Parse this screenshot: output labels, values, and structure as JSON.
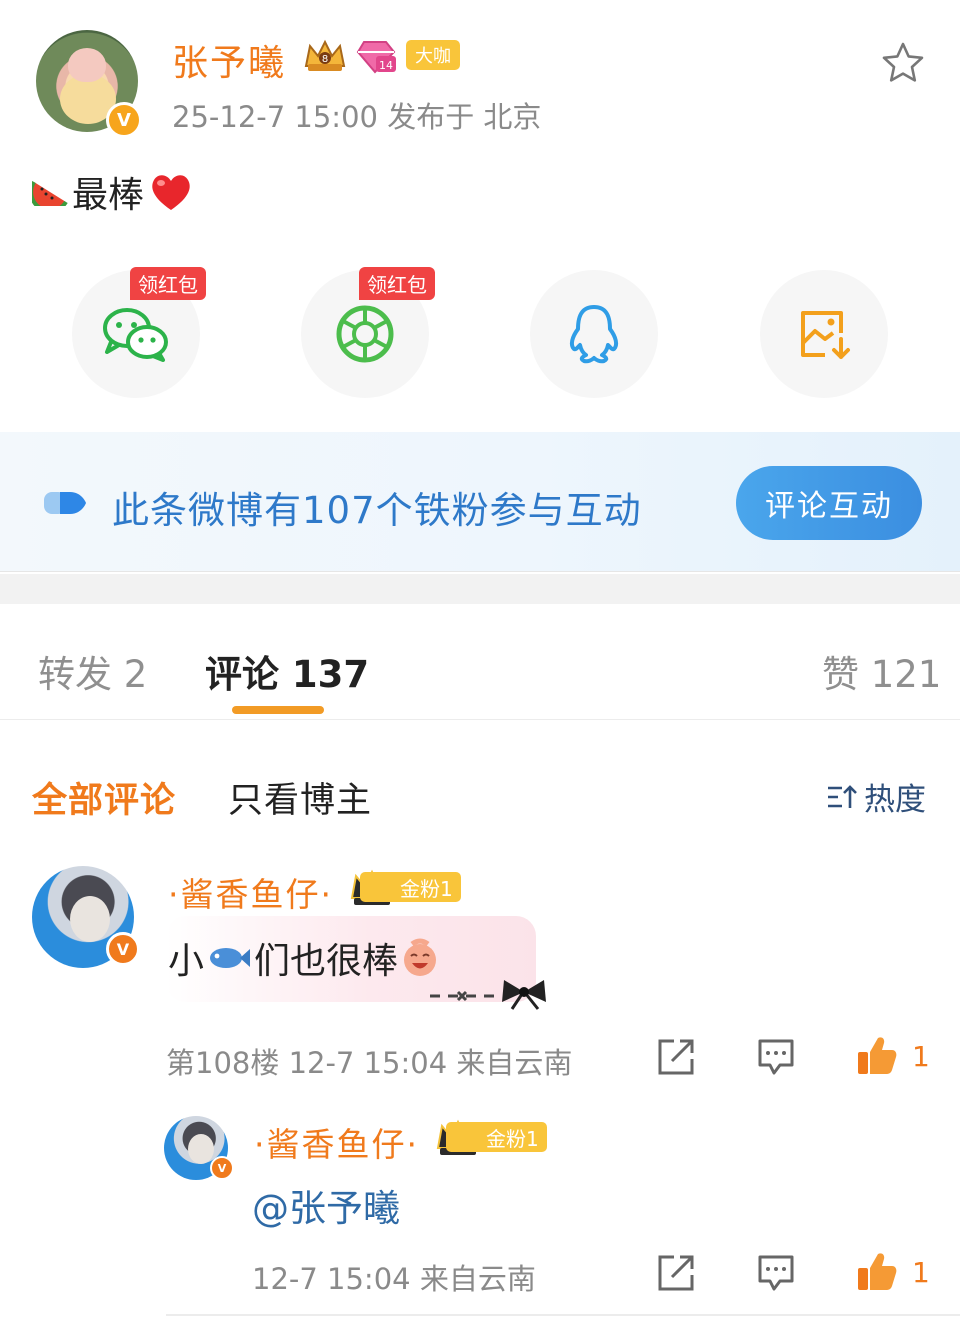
{
  "post": {
    "author_name": "张予曦",
    "crown_level": "8",
    "gem_level": "14",
    "daka_badge": "大咖",
    "meta": "25-12-7 15:00  发布于 北京",
    "text": "最棒"
  },
  "share": {
    "wechat_tag": "领红包",
    "moments_tag": "领红包"
  },
  "iron_fans": {
    "text": "此条微博有107个铁粉参与互动",
    "button_label": "评论互动"
  },
  "tabs": {
    "repost": "转发 2",
    "comments": "评论 137",
    "likes": "赞 121"
  },
  "filters": {
    "all": "全部评论",
    "host_only": "只看博主",
    "sort": "热度"
  },
  "comments": [
    {
      "name": "·酱香鱼仔·",
      "fan_badge": "金粉1",
      "text_before": "小",
      "text_after": "们也很棒",
      "meta": "第108楼  12-7 15:04  来自云南",
      "like_count": "1"
    }
  ],
  "replies": [
    {
      "name": "·酱香鱼仔·",
      "fan_badge": "金粉1",
      "text": "@张予曦",
      "meta": "12-7 15:04  来自云南",
      "like_count": "1"
    }
  ],
  "colors": {
    "accent_orange": "#f07a1c",
    "link_blue": "#2e79c9",
    "badge_gold": "#f9c53a"
  }
}
